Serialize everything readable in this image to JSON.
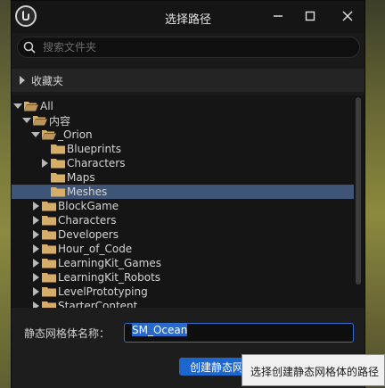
{
  "window": {
    "title": "选择路径",
    "minimize_icon": "minimize-icon",
    "maximize_icon": "maximize-icon",
    "close_icon": "close-icon"
  },
  "search": {
    "placeholder": "搜索文件夹",
    "value": ""
  },
  "favorites": {
    "label": "收藏夹"
  },
  "tree": {
    "items": [
      {
        "label": "All",
        "depth": 0,
        "expanded": true,
        "has_children": true,
        "open_folder": true,
        "selected": false
      },
      {
        "label": "内容",
        "depth": 1,
        "expanded": true,
        "has_children": true,
        "open_folder": true,
        "selected": false
      },
      {
        "label": "_Orion",
        "depth": 2,
        "expanded": true,
        "has_children": true,
        "open_folder": true,
        "selected": false
      },
      {
        "label": "Blueprints",
        "depth": 3,
        "expanded": false,
        "has_children": false,
        "open_folder": false,
        "selected": false
      },
      {
        "label": "Characters",
        "depth": 3,
        "expanded": false,
        "has_children": true,
        "open_folder": false,
        "selected": false
      },
      {
        "label": "Maps",
        "depth": 3,
        "expanded": false,
        "has_children": false,
        "open_folder": false,
        "selected": false
      },
      {
        "label": "Meshes",
        "depth": 3,
        "expanded": false,
        "has_children": false,
        "open_folder": false,
        "selected": true
      },
      {
        "label": "BlockGame",
        "depth": 2,
        "expanded": false,
        "has_children": true,
        "open_folder": false,
        "selected": false
      },
      {
        "label": "Characters",
        "depth": 2,
        "expanded": false,
        "has_children": true,
        "open_folder": false,
        "selected": false
      },
      {
        "label": "Developers",
        "depth": 2,
        "expanded": false,
        "has_children": true,
        "open_folder": false,
        "selected": false
      },
      {
        "label": "Hour_of_Code",
        "depth": 2,
        "expanded": false,
        "has_children": true,
        "open_folder": false,
        "selected": false
      },
      {
        "label": "LearningKit_Games",
        "depth": 2,
        "expanded": false,
        "has_children": true,
        "open_folder": false,
        "selected": false
      },
      {
        "label": "LearningKit_Robots",
        "depth": 2,
        "expanded": false,
        "has_children": true,
        "open_folder": false,
        "selected": false
      },
      {
        "label": "LevelPrototyping",
        "depth": 2,
        "expanded": false,
        "has_children": true,
        "open_folder": false,
        "selected": false
      },
      {
        "label": "StarterContent",
        "depth": 2,
        "expanded": false,
        "has_children": true,
        "open_folder": false,
        "selected": false
      }
    ]
  },
  "name_field": {
    "label": "静态网格体名称：",
    "value": "SM_Ocean"
  },
  "create_button": {
    "label": "创建静态网格体"
  },
  "tooltip": {
    "text": "选择创建静态网格体的路径"
  },
  "colors": {
    "folder": "#d7ad6a",
    "selection": "#3f5578",
    "accent": "#1c66d0"
  }
}
